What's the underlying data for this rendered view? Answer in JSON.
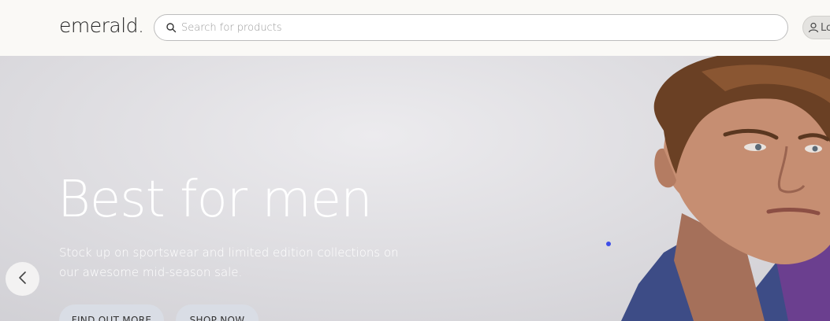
{
  "header": {
    "logo": "emerald.",
    "search": {
      "placeholder": "Search for products",
      "icon": "search-icon"
    },
    "login_label": "Log In"
  },
  "hero": {
    "title": "Best for men",
    "subtitle": "Stock up on sportswear and limited edition collections on our awesome mid-season sale.",
    "buttons": {
      "find_out_more": "FIND OUT MORE",
      "shop_now": "SHOP NOW"
    },
    "prev_icon": "chevron-left-icon"
  },
  "colors": {
    "accent_dot": "#3e4ee8",
    "text_light": "#ffffff",
    "button_bg": "#d9dde5"
  }
}
